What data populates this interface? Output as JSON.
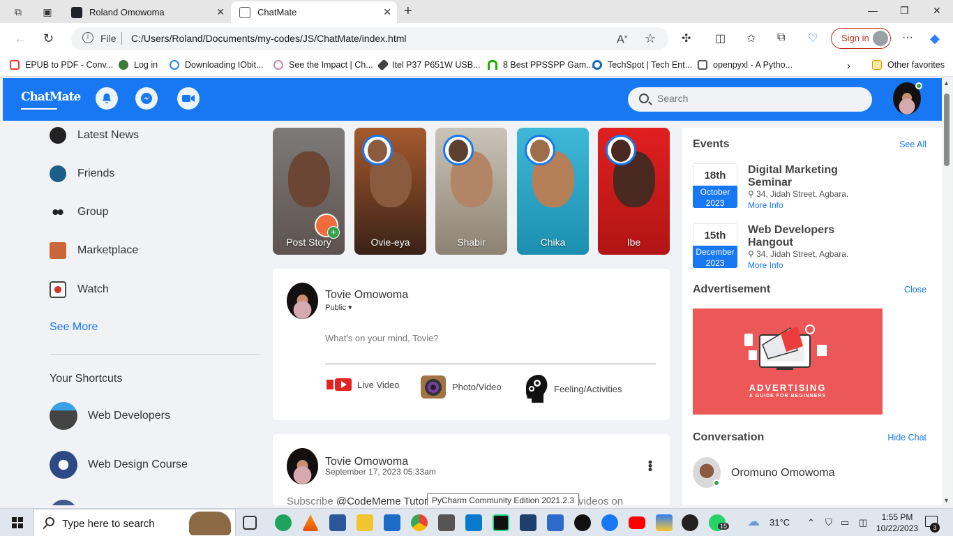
{
  "browser": {
    "tabs": [
      {
        "title": "Roland Omowoma"
      },
      {
        "title": "ChatMate"
      }
    ],
    "address": {
      "scheme_label": "File",
      "url": "C:/Users/Roland/Documents/my-codes/JS/ChatMate/index.html"
    },
    "sign_in_label": "Sign in",
    "bookmarks": [
      {
        "label": "EPUB to PDF - Conv...",
        "icon": "epub-icon",
        "color": "#e03c31"
      },
      {
        "label": "Log in",
        "icon": "frog-icon",
        "color": "#3a7d3a"
      },
      {
        "label": "Downloading IObit...",
        "icon": "iobit-icon",
        "color": "#1e88e5"
      },
      {
        "label": "See the Impact | Ch...",
        "icon": "impact-icon",
        "color": "#c586c0"
      },
      {
        "label": "Itel P37 P651W USB...",
        "icon": "tool-icon",
        "color": "#444444"
      },
      {
        "label": "8 Best PPSSPP Gam...",
        "icon": "game-icon",
        "color": "#1faa00"
      },
      {
        "label": "TechSpot | Tech Ent...",
        "icon": "techspot-icon",
        "color": "#1565c0"
      },
      {
        "label": "openpyxl - A Pytho...",
        "icon": "doc-icon",
        "color": "#555555"
      }
    ],
    "other_favorites": "Other favorites"
  },
  "app": {
    "logo": "ChatMate",
    "search_placeholder": "Search",
    "brand_color": "#1877f2"
  },
  "left_menu": [
    {
      "label": "Latest News",
      "icon": "news-icon"
    },
    {
      "label": "Friends",
      "icon": "friends-icon"
    },
    {
      "label": "Group",
      "icon": "group-icon"
    },
    {
      "label": "Marketplace",
      "icon": "marketplace-icon"
    },
    {
      "label": "Watch",
      "icon": "watch-icon"
    }
  ],
  "see_more": "See More",
  "shortcuts": {
    "title": "Your Shortcuts",
    "items": [
      {
        "label": "Web Developers",
        "icon": "web-dev-icon"
      },
      {
        "label": "Web Design Course",
        "icon": "web-design-icon"
      }
    ]
  },
  "stories": [
    {
      "label": "Post Story"
    },
    {
      "label": "Ovie-eya"
    },
    {
      "label": "Shabir"
    },
    {
      "label": "Chika"
    },
    {
      "label": "Ibe"
    }
  ],
  "create_post": {
    "name": "Tovie Omowoma",
    "privacy": "Public ▾",
    "placeholder": "What's on your mind, Tovie?",
    "actions": [
      {
        "label": "Live Video",
        "icon": "live-video-icon"
      },
      {
        "label": "Photo/Video",
        "icon": "camera-icon"
      },
      {
        "label": "Feeling/Activities",
        "icon": "feeling-icon"
      }
    ]
  },
  "post": {
    "name": "Tovie Omowoma",
    "date": "September 17, 2023 05:33am",
    "text_prefix": "Subscribe",
    "handle": "@CodeMeme Tutor",
    "text_suffix": "ore videos on"
  },
  "tooltip": "PyCharm Community Edition 2021.2.3",
  "events": {
    "title": "Events",
    "see_all": "See All",
    "items": [
      {
        "day": "18th",
        "month": "October",
        "year": "2023",
        "title": "Digital Marketing",
        "title2": "Seminar",
        "location": "34, Jidah Street, Agbara.",
        "more": "More Info"
      },
      {
        "day": "15th",
        "month": "December",
        "year": "2023",
        "title": "Web Developers",
        "title2": "Hangout",
        "location": "34, Jidah Street, Agbara.",
        "more": "More Info"
      }
    ]
  },
  "advertisement": {
    "title": "Advertisement",
    "close": "Close",
    "banner_title": "ADVERTISING",
    "banner_sub": "A GUIDE FOR BEGINNERS"
  },
  "conversation": {
    "title": "Conversation",
    "hide": "Hide Chat",
    "contact": "Oromuno Omowoma"
  },
  "taskbar": {
    "search_label": "Type here to search",
    "weather": "31°C",
    "time": "1:55 PM",
    "date": "10/22/2023",
    "whatsapp_badge": "15",
    "notifications": "3"
  }
}
